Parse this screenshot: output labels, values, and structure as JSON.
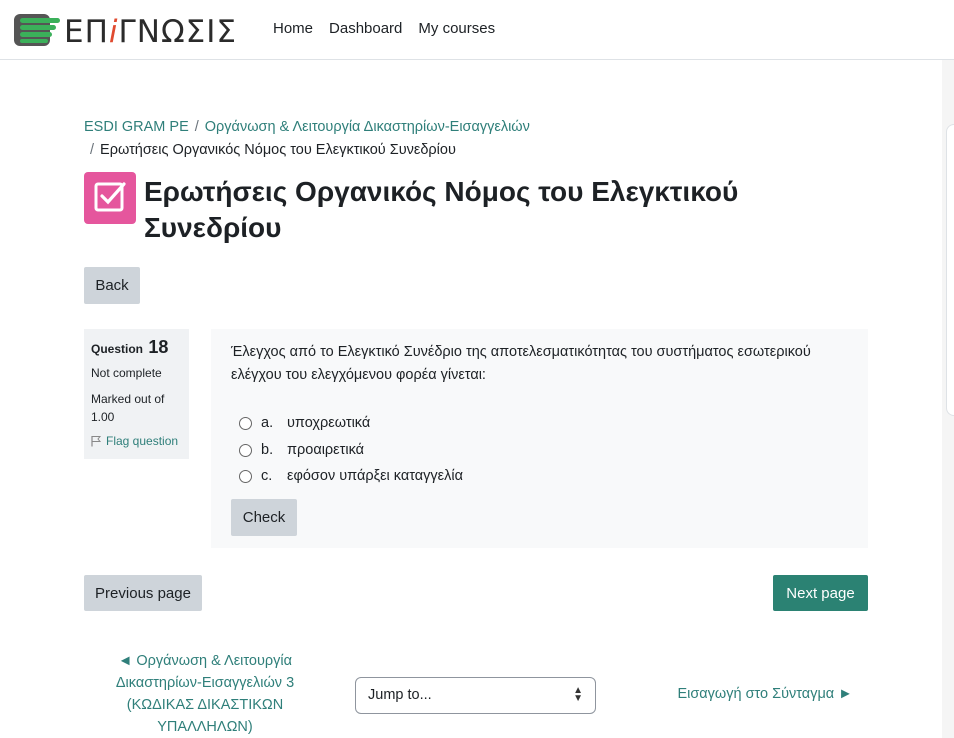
{
  "header": {
    "logo_text_pre": "ΕΠ",
    "logo_text_i": "i",
    "logo_text_post": "ΓΝΩΣΙΣ",
    "nav": [
      "Home",
      "Dashboard",
      "My courses"
    ]
  },
  "breadcrumb": {
    "items": [
      "ESDI GRAM PE",
      "Οργάνωση & Λειτουργία Δικαστηρίων-Εισαγγελιών"
    ],
    "current": "Ερωτήσεις Οργανικός Νόμος του Ελεγκτικού Συνεδρίου",
    "separator": "/"
  },
  "page": {
    "title_line1": "Ερωτήσεις Οργανικός Νόμος του Ελεγκτικού",
    "title_line2": "Συνεδρίου",
    "back_label": "Back",
    "title_icon": "checkbox-icon",
    "title_icon_color": "#e5569d"
  },
  "question_info": {
    "label": "Question",
    "number": "18",
    "state": "Not complete",
    "grade_line1": "Marked out of",
    "grade_line2": "1.00",
    "flag_label": "Flag question"
  },
  "question": {
    "text": "Έλεγχος από το Ελεγκτικό Συνέδριο της αποτελεσματικότητας του συστήματος εσωτερικού ελέγχου του ελεγχόμενου φορέα γίνεται:",
    "answers": [
      {
        "letter": "a.",
        "text": "υποχρεωτικά"
      },
      {
        "letter": "b.",
        "text": "προαιρετικά"
      },
      {
        "letter": "c.",
        "text": "εφόσον υπάρξει καταγγελία"
      }
    ],
    "check_label": "Check"
  },
  "pagination": {
    "previous_label": "Previous page",
    "next_label": "Next page",
    "primary_color": "#2b8273"
  },
  "activity_nav": {
    "previous": "◄ Οργάνωση & Λειτουργία Δικαστηρίων-Εισαγγελιών 3 (ΚΩΔΙΚΑΣ ΔΙΚΑΣΤΙΚΩΝ ΥΠΑΛΛΗΛΩΝ)",
    "jump_placeholder": "Jump to...",
    "next": "Εισαγωγή στο Σύνταγμα ►"
  }
}
